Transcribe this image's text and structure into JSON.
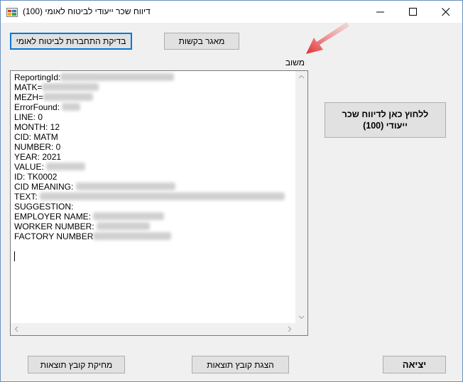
{
  "window": {
    "title": "דיווח שכר ייעודי לביטוח לאומי (100)",
    "icons": {
      "app": "app-icon",
      "minimize": "minimize-icon",
      "maximize": "maximize-icon",
      "close": "close-icon"
    }
  },
  "buttons": {
    "check_connection": "בדיקת התחברות לביטוח לאומי",
    "contacts_db": "מאגר בקשות",
    "send_report": "ללחוץ כאן לדיווח שכר ייעודי (100)",
    "delete_results": "מחיקת קובץ תוצאות",
    "show_results": "הצגת קובץ תוצאות",
    "exit": "יציאה"
  },
  "response": {
    "label": "משוב",
    "lines": [
      {
        "key": "ReportingId:",
        "value": "",
        "redacted": true
      },
      {
        "key": "MATK=",
        "value": "",
        "redacted": true
      },
      {
        "key": "MEZH=",
        "value": "",
        "redacted": true
      },
      {
        "key": "ErrorFound: ",
        "value": "",
        "redacted": true
      },
      {
        "key": "LINE: 0",
        "value": "",
        "redacted": false
      },
      {
        "key": "MONTH: 12",
        "value": "",
        "redacted": false
      },
      {
        "key": "CID: MATM",
        "value": "",
        "redacted": false
      },
      {
        "key": "NUMBER: 0",
        "value": "",
        "redacted": false
      },
      {
        "key": "YEAR: 2021",
        "value": "",
        "redacted": false
      },
      {
        "key": "VALUE: ",
        "value": "",
        "redacted": true
      },
      {
        "key": "ID: TK0002",
        "value": "",
        "redacted": false
      },
      {
        "key": "CID MEANING: ",
        "value": "",
        "redacted": true
      },
      {
        "key": "TEXT: ",
        "value": "",
        "redacted": true
      },
      {
        "key": "SUGGESTION:",
        "value": "",
        "redacted": false
      },
      {
        "key": "EMPLOYER NAME: ",
        "value": "",
        "redacted": true
      },
      {
        "key": "WORKER NUMBER: ",
        "value": "",
        "redacted": true
      },
      {
        "key": "FACTORY NUMBER",
        "value": "",
        "redacted": true
      }
    ]
  },
  "colors": {
    "accent": "#0078d7",
    "arrow": "#e32b2b",
    "background": "#f0f0f0"
  }
}
